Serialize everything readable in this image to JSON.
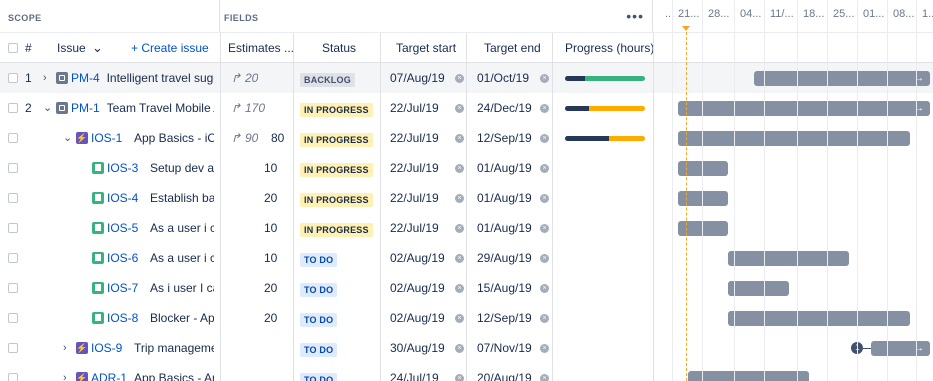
{
  "headers": {
    "scope": "SCOPE",
    "fields": "FIELDS",
    "more": "•••",
    "number": "#",
    "issue": "Issue",
    "issue_chevron": "⌄",
    "create_issue": "+ Create issue",
    "estimates": "Estimates ...",
    "status": "Status",
    "target_start": "Target start",
    "target_end": "Target end",
    "progress": "Progress (hours)"
  },
  "timeline": {
    "columns": [
      "...",
      "21...",
      "28...",
      "04...",
      "11/...",
      "18...",
      "25...",
      "01...",
      "08...",
      "1..."
    ]
  },
  "rows": [
    {
      "num": "1",
      "chevron": "›",
      "icon": "project-icon",
      "key": "PM-4",
      "title": "Intelligent travel sugg",
      "estimate": "20",
      "rollup": true,
      "status": "BACKLOG",
      "status_kind": "backlog",
      "start": "07/Aug/19",
      "end": "01/Oct/19",
      "progress": {
        "done": 0.25,
        "remaining": 0.75,
        "remaining_color": "#36b37e"
      },
      "bar": {
        "from": 0.3,
        "to": 1.0,
        "arrow": true
      }
    },
    {
      "num": "2",
      "chevron": "⌄",
      "icon": "project-icon",
      "key": "PM-1",
      "title": "Team Travel Mobile Ap",
      "estimate": "170",
      "rollup": true,
      "status": "IN PROGRESS",
      "status_kind": "progress",
      "start": "22/Jul/19",
      "end": "24/Dec/19",
      "progress": {
        "done": 0.3,
        "remaining": 0.7,
        "remaining_color": "#ffab00"
      },
      "bar": {
        "from": 0.0,
        "to": 1.0,
        "arrow": true
      }
    },
    {
      "num": "",
      "chevron": "⌄",
      "icon": "epic-icon",
      "key": "IOS-1",
      "title": "App Basics - iOS",
      "estimate": "90",
      "estimate_extra": "80",
      "rollup": true,
      "status": "IN PROGRESS",
      "status_kind": "progress",
      "start": "22/Jul/19",
      "end": "12/Sep/19",
      "progress": {
        "done": 0.55,
        "remaining": 0.45,
        "remaining_color": "#ffab00"
      },
      "bar": {
        "from": 0.0,
        "to": 0.92,
        "arrow": false
      }
    },
    {
      "num": "",
      "chevron": "",
      "icon": "story-icon",
      "key": "IOS-3",
      "title": "Setup dev anc",
      "estimate": "10",
      "rollup": false,
      "status": "IN PROGRESS",
      "status_kind": "progress",
      "start": "22/Jul/19",
      "end": "01/Aug/19",
      "bar": {
        "from": 0.0,
        "to": 0.2,
        "arrow": false
      }
    },
    {
      "num": "",
      "chevron": "",
      "icon": "story-icon",
      "key": "IOS-4",
      "title": "Establish basic",
      "estimate": "20",
      "rollup": false,
      "status": "IN PROGRESS",
      "status_kind": "progress",
      "start": "22/Jul/19",
      "end": "01/Aug/19",
      "bar": {
        "from": 0.0,
        "to": 0.2,
        "arrow": false
      }
    },
    {
      "num": "",
      "chevron": "",
      "icon": "story-icon",
      "key": "IOS-5",
      "title": "As a user i can",
      "estimate": "10",
      "rollup": false,
      "status": "IN PROGRESS",
      "status_kind": "progress",
      "start": "22/Jul/19",
      "end": "01/Aug/19",
      "bar": {
        "from": 0.0,
        "to": 0.2,
        "arrow": false
      }
    },
    {
      "num": "",
      "chevron": "",
      "icon": "story-icon",
      "key": "IOS-6",
      "title": "As a user i can",
      "estimate": "10",
      "rollup": false,
      "status": "TO DO",
      "status_kind": "todo",
      "start": "02/Aug/19",
      "end": "29/Aug/19",
      "bar": {
        "from": 0.2,
        "to": 0.68,
        "arrow": false
      }
    },
    {
      "num": "",
      "chevron": "",
      "icon": "story-icon",
      "key": "IOS-7",
      "title": "As i user I can n",
      "estimate": "20",
      "rollup": false,
      "status": "TO DO",
      "status_kind": "todo",
      "start": "02/Aug/19",
      "end": "15/Aug/19",
      "bar": {
        "from": 0.2,
        "to": 0.44,
        "arrow": false
      }
    },
    {
      "num": "",
      "chevron": "",
      "icon": "story-icon",
      "key": "IOS-8",
      "title": "Blocker - App B",
      "estimate": "20",
      "rollup": false,
      "status": "TO DO",
      "status_kind": "todo",
      "start": "02/Aug/19",
      "end": "12/Sep/19",
      "bar": {
        "from": 0.2,
        "to": 0.92,
        "arrow": false
      }
    },
    {
      "num": "",
      "chevron": "›",
      "icon": "epic-icon",
      "key": "IOS-9",
      "title": "Trip management",
      "estimate": "",
      "rollup": false,
      "status": "TO DO",
      "status_kind": "todo",
      "start": "30/Aug/19",
      "end": "07/Nov/19",
      "bar": {
        "from": 0.68,
        "to": 1.0,
        "arrow": true
      },
      "dependency": "1"
    },
    {
      "num": "",
      "chevron": "›",
      "icon": "epic-icon",
      "key": "ADR-1",
      "title": "App Basics - And",
      "estimate": "",
      "rollup": false,
      "status": "TO DO",
      "status_kind": "todo",
      "start": "24/Jul/19",
      "end": "20/Aug/19",
      "bar": {
        "from": 0.04,
        "to": 0.52,
        "arrow": false
      }
    }
  ]
}
